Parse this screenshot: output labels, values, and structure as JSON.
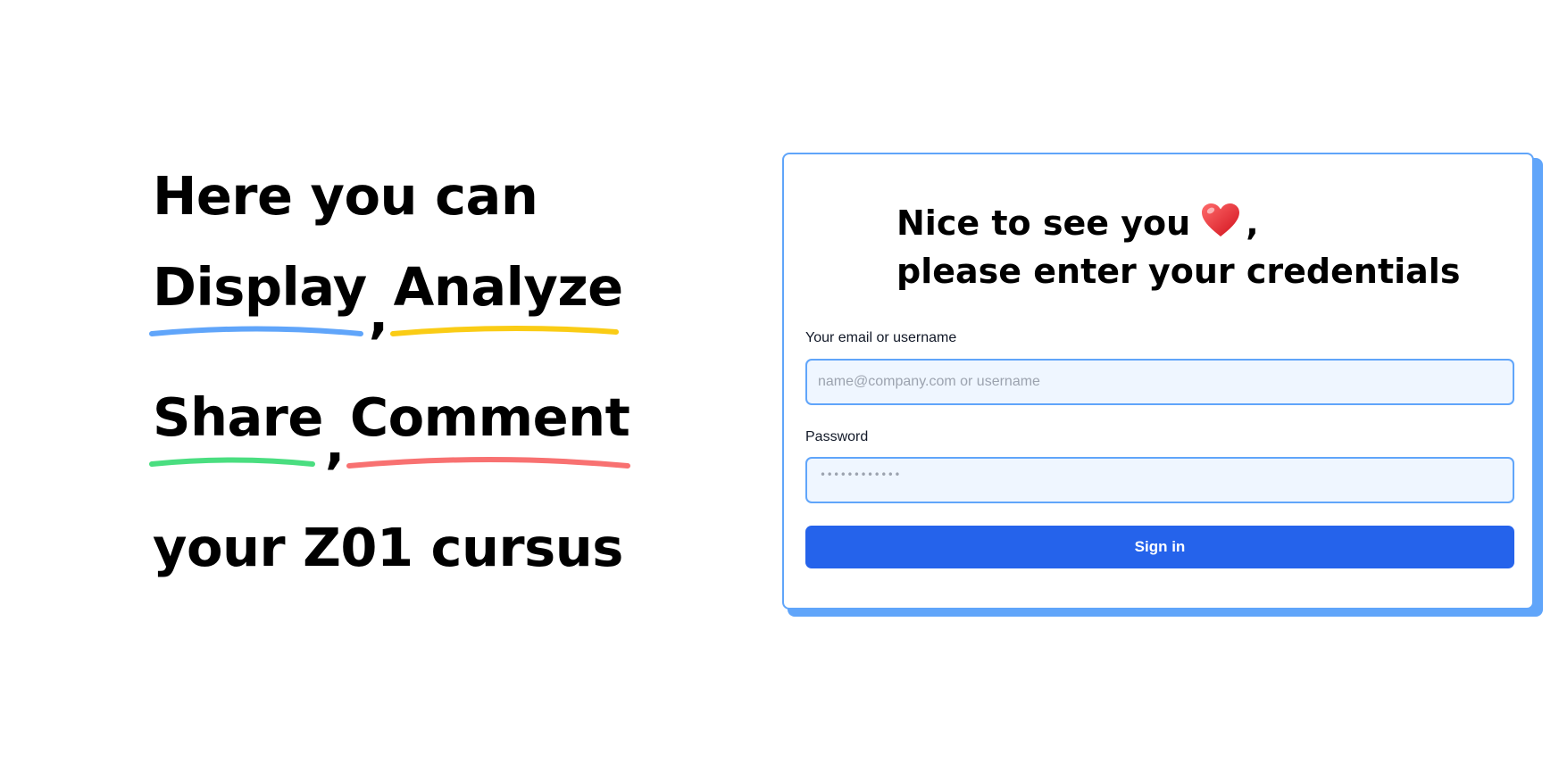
{
  "hero": {
    "line1": "Here you can",
    "word_display": "Display",
    "word_analyze": "Analyze",
    "word_share": "Share",
    "word_comment": "Comment",
    "comma": ",",
    "line4": "your Z01 cursus"
  },
  "colors": {
    "display_underline": "#60a5fa",
    "analyze_underline": "#facc15",
    "share_underline": "#4ade80",
    "comment_underline": "#f87171",
    "card_border": "#60a5fa",
    "button": "#2563eb",
    "input_bg": "#eff6ff"
  },
  "login": {
    "greeting_line1": "Nice to see you",
    "greeting_heart_icon": "heart-icon",
    "greeting_comma": ",",
    "greeting_line2": "please enter your credentials",
    "email_label": "Your email or username",
    "email_placeholder": "name@company.com or username",
    "password_label": "Password",
    "password_mask": "••••••••••••",
    "signin_label": "Sign in"
  }
}
